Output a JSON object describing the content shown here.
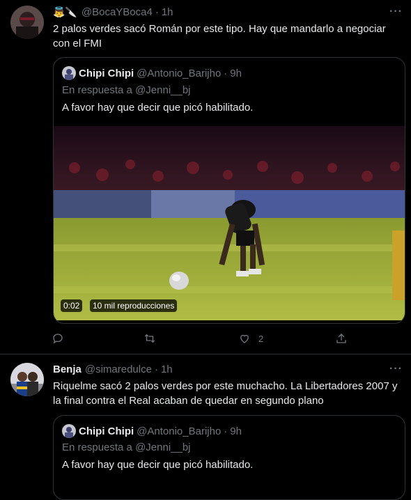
{
  "tweet1": {
    "display_name_emoji": "👼🔪",
    "handle": "@BocaYBoca4",
    "time": "1h",
    "text": "2 palos verdes sacó Román por este tipo. Hay que mandarlo a negociar con el FMI",
    "quote": {
      "name": "Chipi Chipi",
      "handle": "@Antonio_Barijho",
      "time": "9h",
      "reply_to": "En respuesta a @Jenni__bj",
      "text": "A favor hay que decir que picó habilitado.",
      "video_time": "0:02",
      "video_views": "10 mil reproducciones"
    },
    "like_count": "2"
  },
  "tweet2": {
    "name": "Benja",
    "handle": "@simaredulce",
    "time": "1h",
    "text": "Riquelme sacó 2 palos verdes por este muchacho. La Libertadores 2007 y la final contra el Real acaban de quedar en segundo plano",
    "quote": {
      "name": "Chipi Chipi",
      "handle": "@Antonio_Barijho",
      "time": "9h",
      "reply_to": "En respuesta a @Jenni__bj",
      "text": "A favor hay que decir que picó habilitado."
    }
  },
  "separator": "·",
  "more_icon": "···",
  "colors": {
    "background": "#000000",
    "text": "#e7e9ea",
    "muted": "#71767b",
    "border": "#2f3336"
  }
}
